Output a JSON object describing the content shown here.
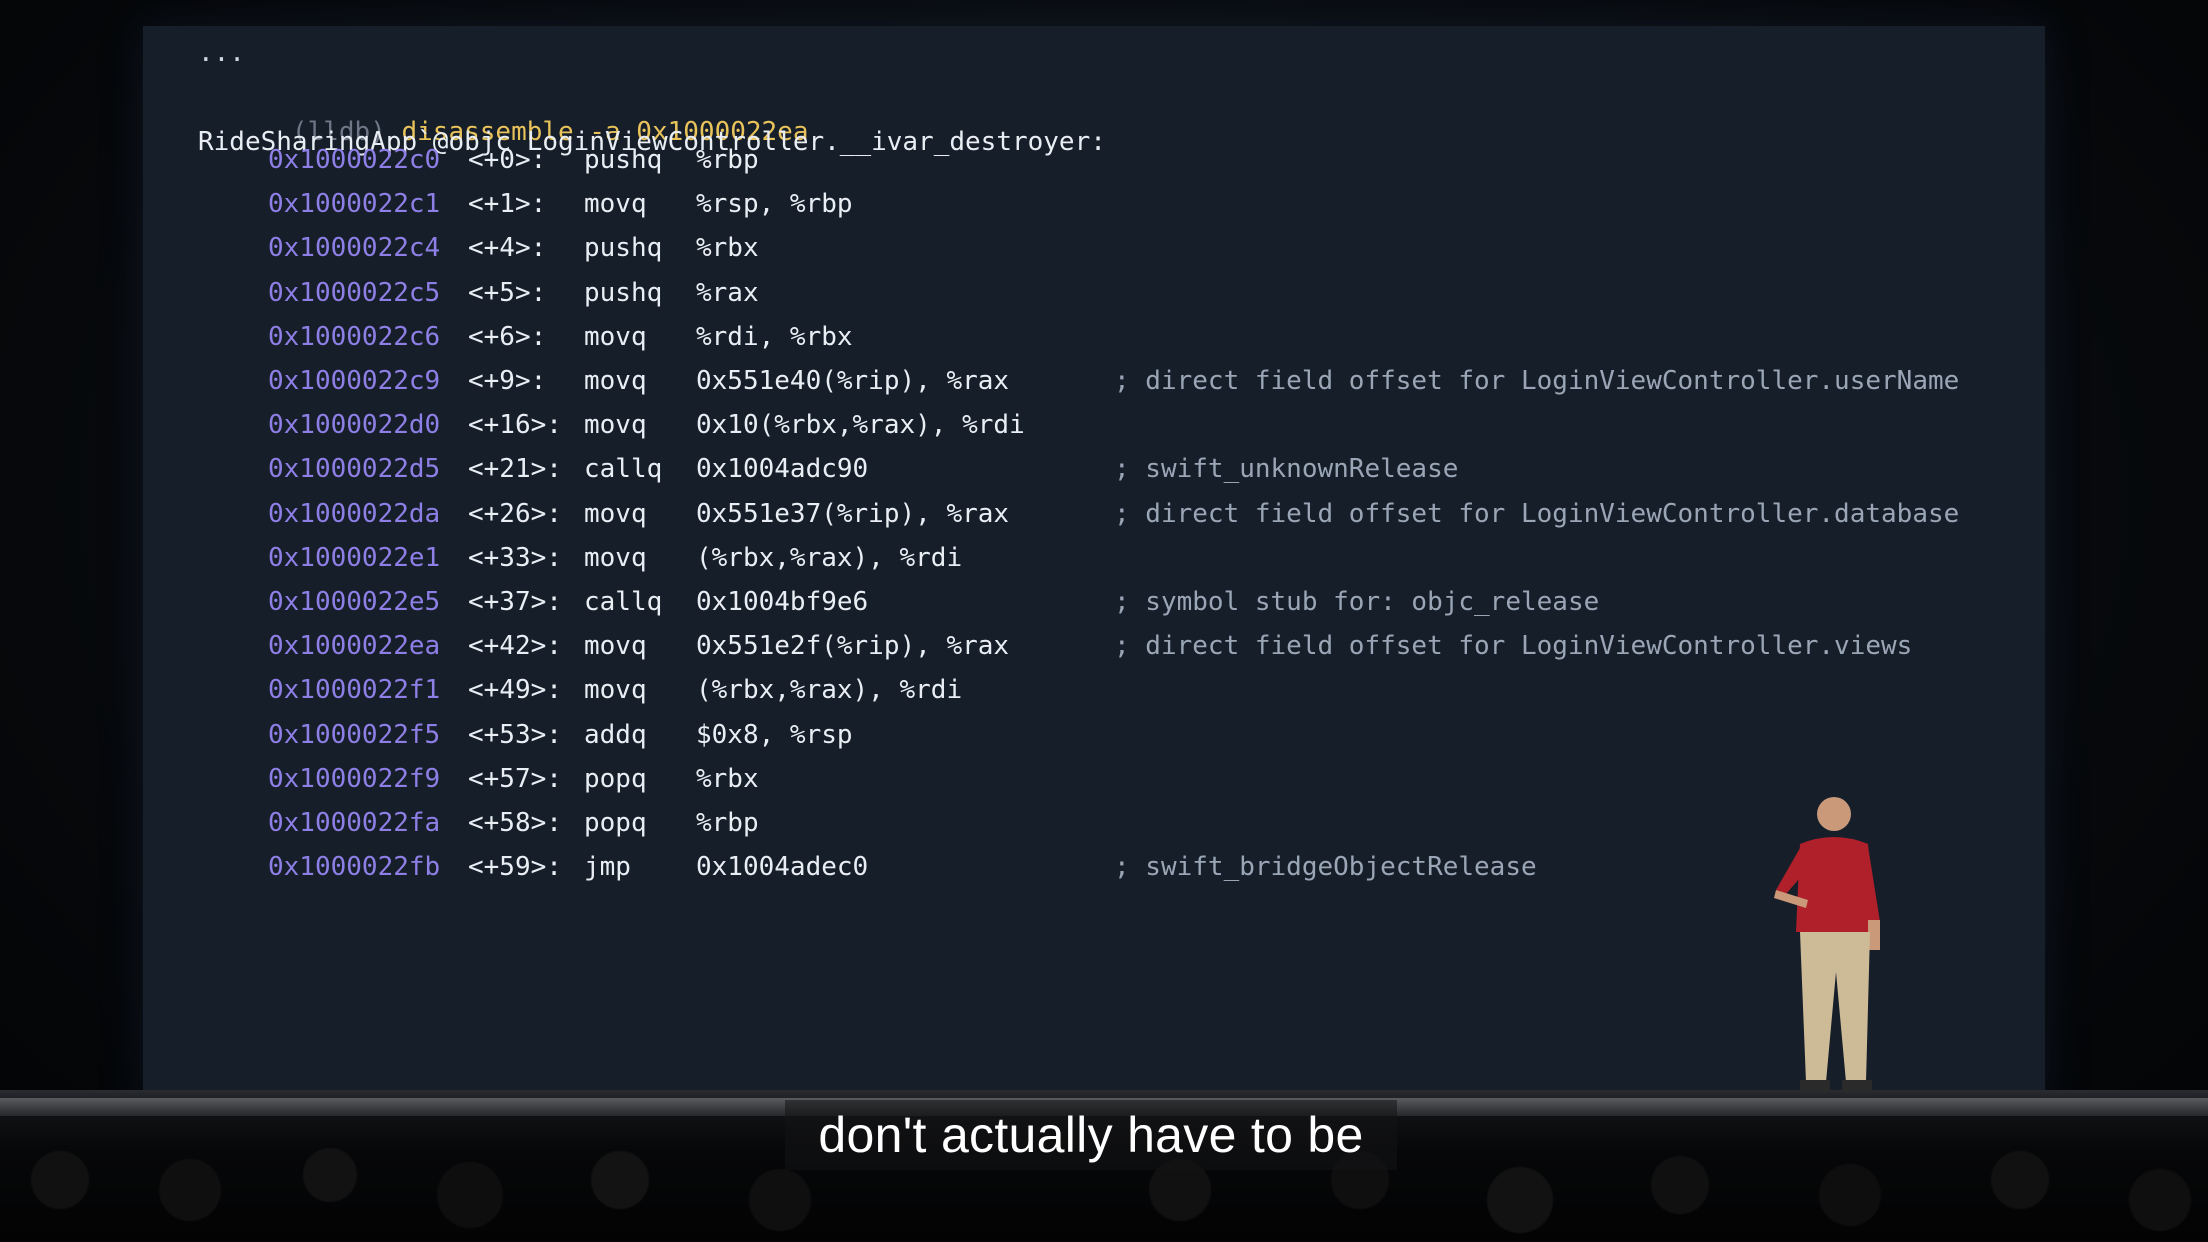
{
  "terminal": {
    "ellipsis": "...",
    "prompt": "(lldb)",
    "command": "disassemble -a 0x1000022ea",
    "header": "RideSharingApp`@objc LoginViewController.__ivar_destroyer:",
    "rows": [
      {
        "addr": "0x1000022c0",
        "off": "<+0>:",
        "op": "pushq",
        "args": "%rbp",
        "comment": ""
      },
      {
        "addr": "0x1000022c1",
        "off": "<+1>:",
        "op": "movq",
        "args": "%rsp, %rbp",
        "comment": ""
      },
      {
        "addr": "0x1000022c4",
        "off": "<+4>:",
        "op": "pushq",
        "args": "%rbx",
        "comment": ""
      },
      {
        "addr": "0x1000022c5",
        "off": "<+5>:",
        "op": "pushq",
        "args": "%rax",
        "comment": ""
      },
      {
        "addr": "0x1000022c6",
        "off": "<+6>:",
        "op": "movq",
        "args": "%rdi, %rbx",
        "comment": ""
      },
      {
        "addr": "0x1000022c9",
        "off": "<+9>:",
        "op": "movq",
        "args": "0x551e40(%rip), %rax",
        "comment": "; direct field offset for LoginViewController.userName"
      },
      {
        "addr": "0x1000022d0",
        "off": "<+16>:",
        "op": "movq",
        "args": "0x10(%rbx,%rax), %rdi",
        "comment": ""
      },
      {
        "addr": "0x1000022d5",
        "off": "<+21>:",
        "op": "callq",
        "args": "0x1004adc90",
        "comment": "; swift_unknownRelease"
      },
      {
        "addr": "0x1000022da",
        "off": "<+26>:",
        "op": "movq",
        "args": "0x551e37(%rip), %rax",
        "comment": "; direct field offset for LoginViewController.database"
      },
      {
        "addr": "0x1000022e1",
        "off": "<+33>:",
        "op": "movq",
        "args": "(%rbx,%rax), %rdi",
        "comment": ""
      },
      {
        "addr": "0x1000022e5",
        "off": "<+37>:",
        "op": "callq",
        "args": "0x1004bf9e6",
        "comment": "; symbol stub for: objc_release"
      },
      {
        "addr": "0x1000022ea",
        "off": "<+42>:",
        "op": "movq",
        "args": "0x551e2f(%rip), %rax",
        "comment": "; direct field offset for LoginViewController.views"
      },
      {
        "addr": "0x1000022f1",
        "off": "<+49>:",
        "op": "movq",
        "args": "(%rbx,%rax), %rdi",
        "comment": ""
      },
      {
        "addr": "0x1000022f5",
        "off": "<+53>:",
        "op": "addq",
        "args": "$0x8, %rsp",
        "comment": ""
      },
      {
        "addr": "0x1000022f9",
        "off": "<+57>:",
        "op": "popq",
        "args": "%rbx",
        "comment": ""
      },
      {
        "addr": "0x1000022fa",
        "off": "<+58>:",
        "op": "popq",
        "args": "%rbp",
        "comment": ""
      },
      {
        "addr": "0x1000022fb",
        "off": "<+59>:",
        "op": "jmp",
        "args": "0x1004adec0",
        "comment": "; swift_bridgeObjectRelease"
      }
    ]
  },
  "caption": "don't actually have to be",
  "colors": {
    "screen": "#161e29",
    "address": "#8e7fe6",
    "command": "#e8c25a",
    "comment": "#9aa6b6",
    "presenter_shirt": "#b0202a"
  }
}
